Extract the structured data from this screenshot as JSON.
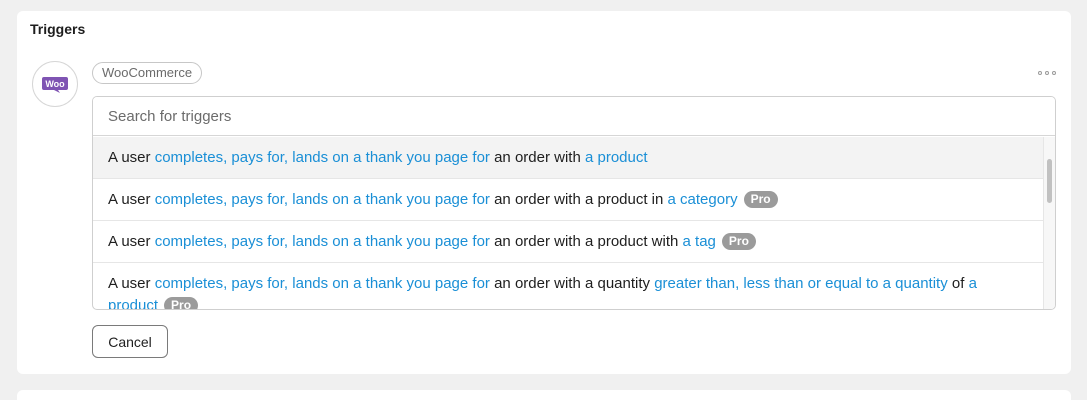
{
  "section": {
    "title": "Triggers"
  },
  "integration": {
    "name": "WooCommerce",
    "logo_text": "Woo",
    "logo_color": "#7f54b3",
    "more_icon": "more-horizontal-icon"
  },
  "search": {
    "placeholder": "Search for triggers",
    "value": ""
  },
  "triggers": [
    {
      "parts": [
        "A user ",
        "completes, pays for, lands on a thank you page for",
        " an order with ",
        "a product"
      ],
      "pro": ""
    },
    {
      "parts": [
        "A user ",
        "completes, pays for, lands on a thank you page for",
        " an order with a product in ",
        "a category"
      ],
      "pro": "Pro"
    },
    {
      "parts": [
        "A user ",
        "completes, pays for, lands on a thank you page for",
        " an order with a product with ",
        "a tag"
      ],
      "pro": "Pro"
    },
    {
      "parts": [
        "A user ",
        "completes, pays for, lands on a thank you page for",
        " an order with a quantity ",
        "greater than, less than or equal to a quantity",
        " of ",
        "a product"
      ],
      "pro": "Pro"
    }
  ],
  "actions": {
    "cancel_label": "Cancel"
  },
  "colors": {
    "link": "#1a8fd6",
    "pro_badge": "#9b9b9b"
  }
}
